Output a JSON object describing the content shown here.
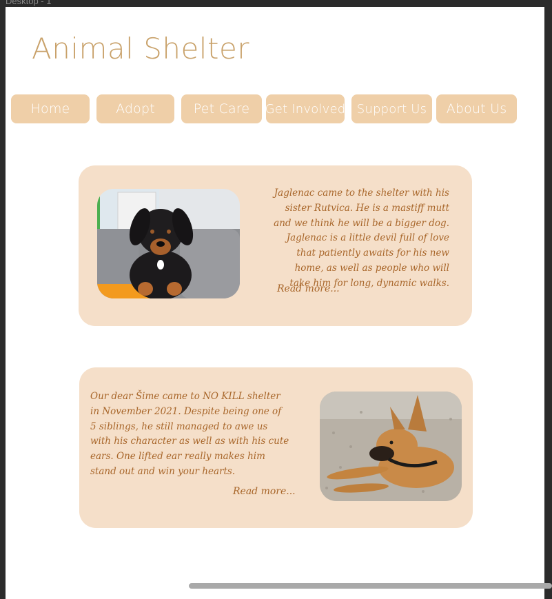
{
  "window": {
    "label": "Desktop - 1"
  },
  "site": {
    "title": "Animal Shelter"
  },
  "nav": {
    "items": [
      {
        "label": "Home"
      },
      {
        "label": "Adopt"
      },
      {
        "label": "Pet Care"
      },
      {
        "label": "Get Involved"
      },
      {
        "label": "Support Us"
      },
      {
        "label": "About Us"
      }
    ]
  },
  "colors": {
    "title": "#c9a26b",
    "nav_button": "#efcfa8",
    "card_background": "#f5dfc9",
    "story_text": "#a8662a"
  },
  "stories": [
    {
      "image_icon": "puppy-photo",
      "text": "Jaglenac came to the shelter with his sister Rutvica.  He is a mastiff mutt and we think he will be a bigger dog. Jaglenac is a little devil full of love that patiently awaits for his new home, as well as people who will take him for long, dynamic walks.",
      "read_more": "Read more..."
    },
    {
      "image_icon": "dog-photo",
      "text": "Our dear Šime came to  NO KILL shelter in November 2021. Despite being one of 5 siblings, he still managed to awe us with his character as well as with his cute ears. One lifted ear really makes him stand out and win your hearts.",
      "read_more": "Read more..."
    }
  ]
}
